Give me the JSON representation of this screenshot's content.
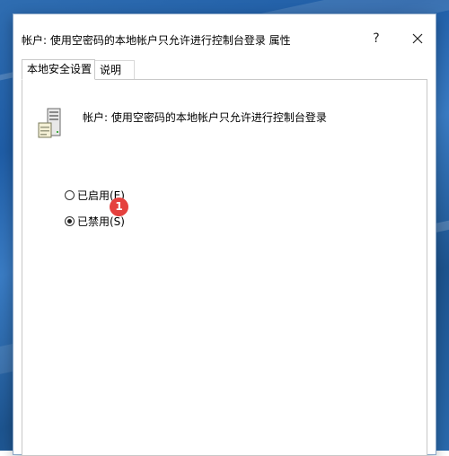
{
  "window": {
    "title": "帐户: 使用空密码的本地帐户只允许进行控制台登录 属性",
    "help_glyph": "?"
  },
  "tabs": [
    {
      "label": "本地安全设置",
      "active": true
    },
    {
      "label": "说明",
      "active": false
    }
  ],
  "policy": {
    "name": "帐户: 使用空密码的本地帐户只允许进行控制台登录",
    "icon": "server-icon"
  },
  "options": [
    {
      "label": "已启用(E)",
      "selected": false
    },
    {
      "label": "已禁用(S)",
      "selected": true
    }
  ],
  "annotation": {
    "badge_text": "1",
    "badge_color": "#e5413e"
  }
}
